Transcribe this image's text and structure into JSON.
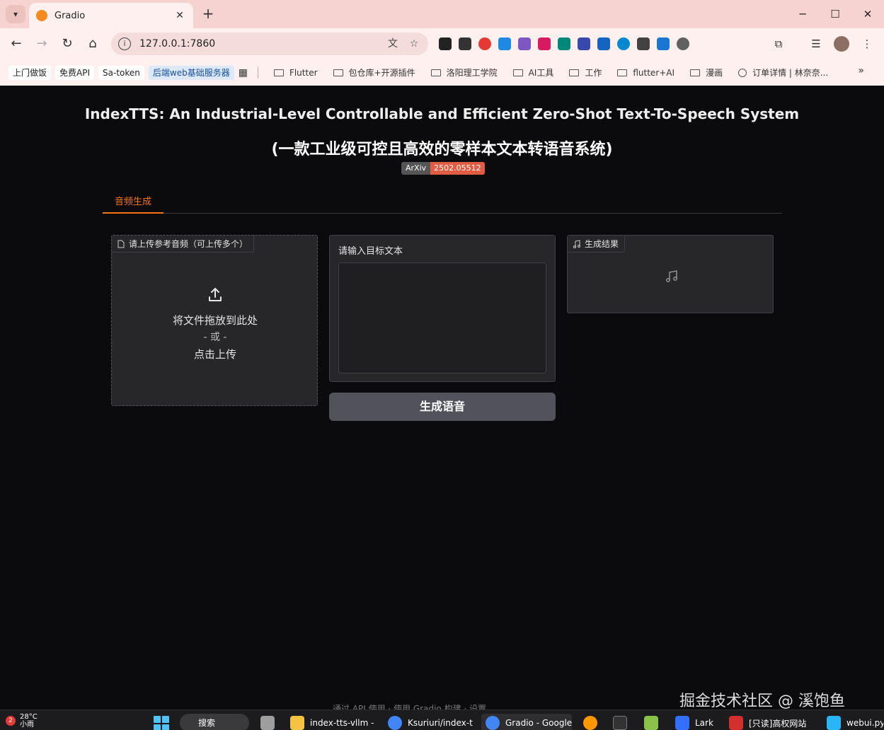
{
  "browser": {
    "tab_title": "Gradio",
    "tab_close": "✕",
    "new_tab": "+",
    "url": "127.0.0.1:7860",
    "bookmarks": {
      "chips": [
        "上门做饭",
        "免费API",
        "Sa-token"
      ],
      "chip_highlight": "后端web基础服务器",
      "folders": [
        "Flutter",
        "包仓库+开源插件",
        "洛阳理工学院",
        "AI工具",
        "工作",
        "flutter+AI",
        "漫画",
        "订单详情 | 林奈奈..."
      ]
    }
  },
  "app": {
    "title": "IndexTTS: An Industrial-Level Controllable and Efficient Zero-Shot Text-To-Speech System",
    "subtitle": "(一款工业级可控且高效的零样本文本转语音系统)",
    "badge_left": "ArXiv",
    "badge_right": "2502.05512",
    "tab_label": "音频生成",
    "upload": {
      "label": "请上传参考音频（可上传多个）",
      "drop_text": "将文件拖放到此处",
      "or_text": "- 或 -",
      "click_text": "点击上传"
    },
    "textbox": {
      "label": "请输入目标文本",
      "value": ""
    },
    "generate_button": "生成语音",
    "result_label": "生成结果",
    "footer_partial": "通过 API 使用 · 使用 Gradio 构建 · 设置",
    "watermark": "掘金技术社区 @ 溪饱鱼"
  },
  "taskbar": {
    "weather_badge": "2",
    "temperature": "28°C",
    "weather_desc": "小雨",
    "search_label": "搜索",
    "apps": [
      {
        "label": "index-tts-vllm -",
        "color": "#f5c242"
      },
      {
        "label": "Ksuriuri/index-tt",
        "color": "#4285f4"
      },
      {
        "label": "Gradio - Google",
        "color": "#4285f4"
      },
      {
        "label": "Lark",
        "color": "#3370ff"
      },
      {
        "label": "[只读]高权网站",
        "color": "#d32f2f"
      },
      {
        "label": "webui.py",
        "color": "#29b6f6"
      }
    ]
  },
  "colors": {
    "accent": "#f97316",
    "badge_red": "#e05d44",
    "panel": "#27272a"
  }
}
